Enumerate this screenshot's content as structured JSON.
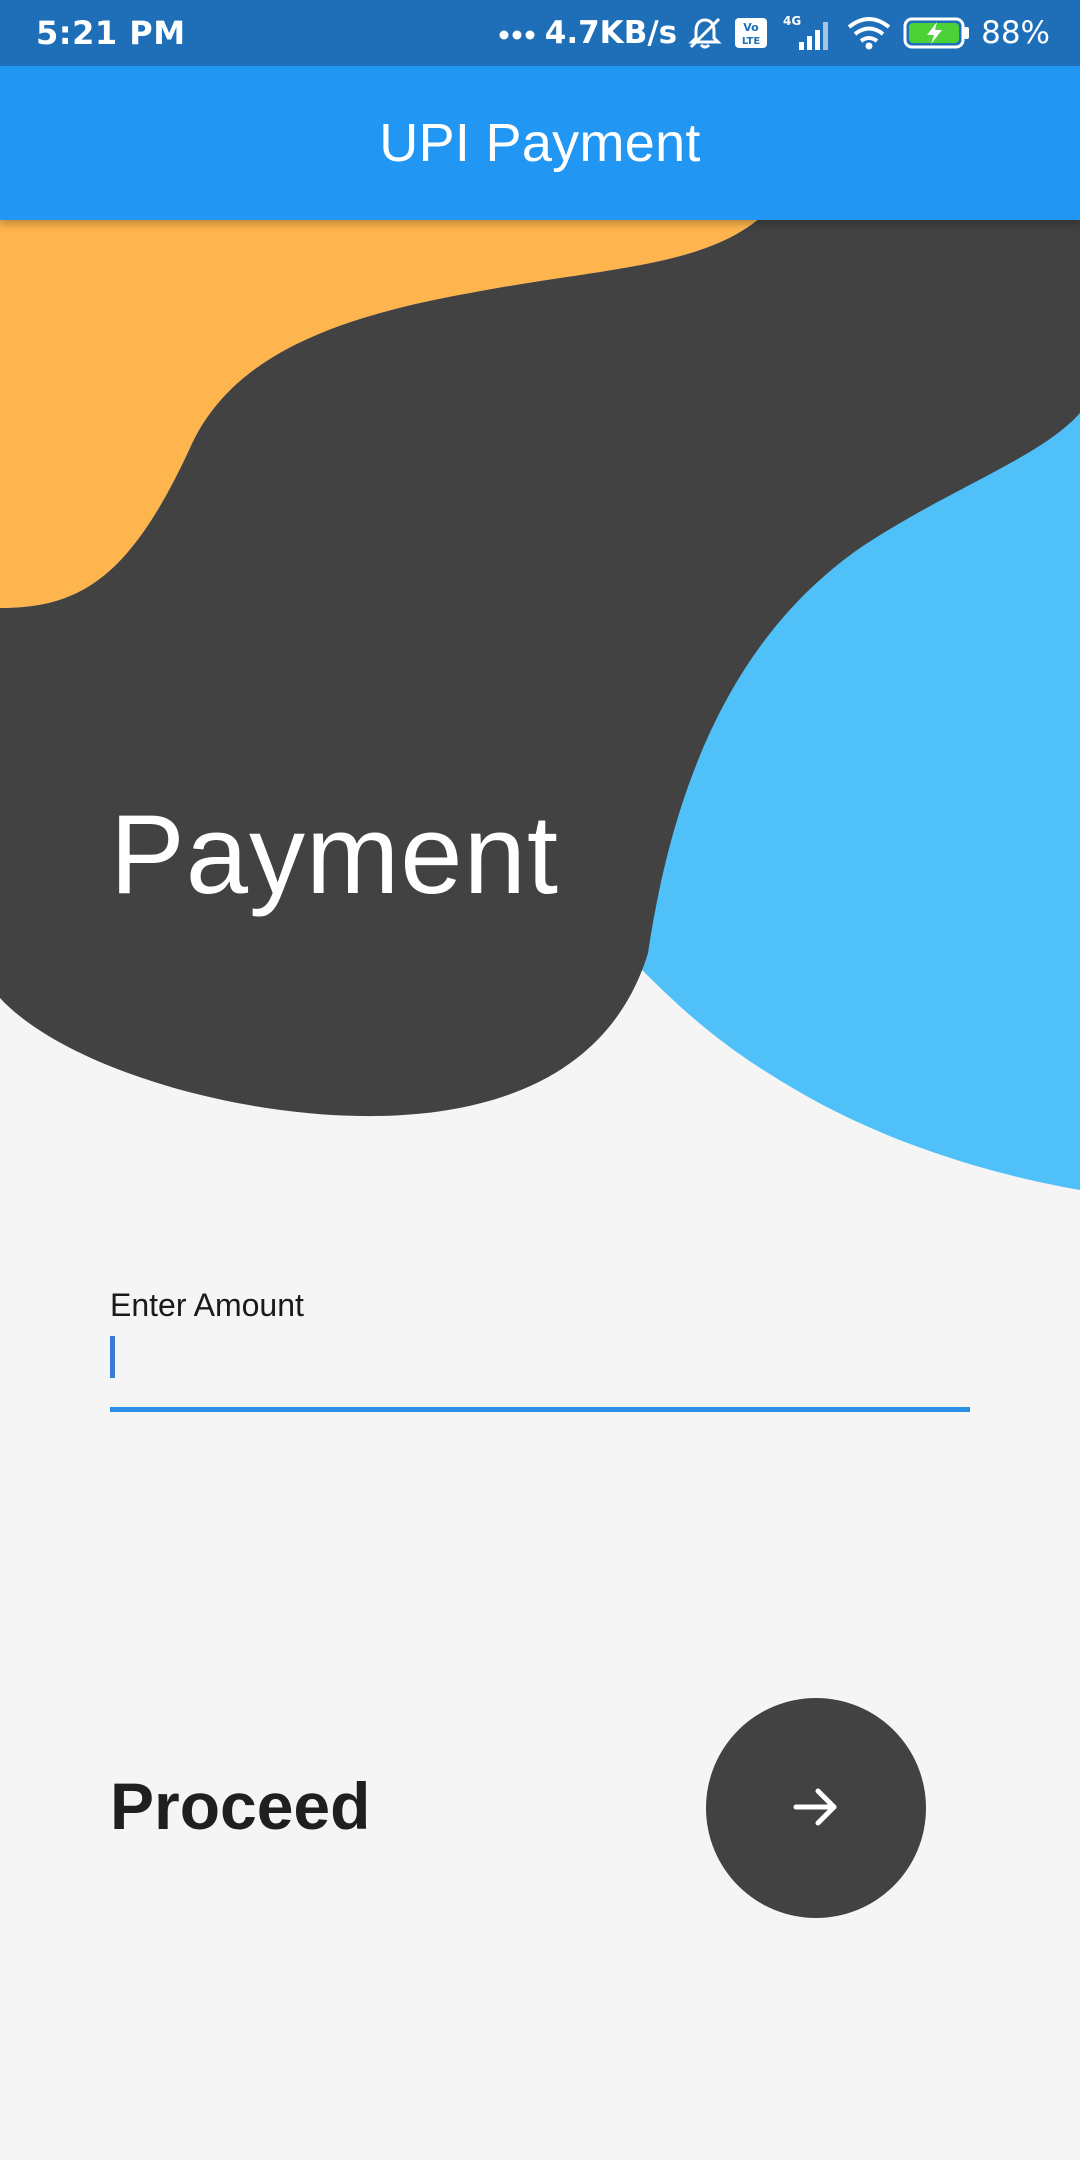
{
  "status_bar": {
    "time": "5:21 PM",
    "network_speed": "4.7KB/s",
    "network_type": "4G",
    "volte_label": "Vo LTE",
    "battery": "88%",
    "icons": [
      "more-dots-icon",
      "mute-bell-icon",
      "volte-icon",
      "signal-icon",
      "wifi-icon",
      "battery-charging-icon"
    ]
  },
  "app_bar": {
    "title": "UPI Payment"
  },
  "hero": {
    "title": "Payment"
  },
  "amount_field": {
    "label": "Enter Amount",
    "value": "",
    "placeholder": ""
  },
  "proceed": {
    "label": "Proceed",
    "button_icon": "arrow-right-icon"
  },
  "colors": {
    "status_bar": "#1e6fb8",
    "app_bar": "#2196f3",
    "blob_orange": "#ffb54d",
    "blob_dark": "#424242",
    "blob_blue": "#4fc1f8",
    "background": "#f5f5f5",
    "input_underline": "#2c8fe6",
    "fab": "#424242"
  }
}
